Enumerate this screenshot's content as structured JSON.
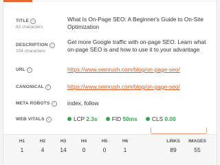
{
  "fields": {
    "title": {
      "label": "TITLE",
      "sub": "63 characters",
      "value": "What Is On-Page SEO: A Beginner's Guide to On-Site Optimization"
    },
    "description": {
      "label": "DESCRIPTION",
      "sub": "104 characters",
      "value": "Get more Google traffic with on-page SEO. Learn what on-page SEO is and how to use it to your advantage"
    },
    "url": {
      "label": "URL",
      "value": "https://www.semrush.com/blog/on-page-seo/"
    },
    "canonical": {
      "label": "CANONICAL",
      "value": "https://www.semrush.com/blog/on-page-seo/"
    },
    "meta_robots": {
      "label": "META ROBOTS",
      "value": "index, follow"
    },
    "web_vitals": {
      "label": "WEB VITALS",
      "items": [
        {
          "name": "LCP",
          "value": "2.3s"
        },
        {
          "name": "FID",
          "value": "50ms"
        },
        {
          "name": "CLS",
          "value": "0.00"
        }
      ]
    }
  },
  "info_glyph": "i",
  "stats": [
    {
      "label": "H1",
      "value": "1"
    },
    {
      "label": "H2",
      "value": "4"
    },
    {
      "label": "H3",
      "value": "14"
    },
    {
      "label": "H4",
      "value": "0"
    },
    {
      "label": "H5",
      "value": "0"
    },
    {
      "label": "H6",
      "value": "1"
    },
    {
      "label": "LINKS",
      "value": "89"
    },
    {
      "label": "IMAGES",
      "value": "55"
    }
  ],
  "colors": {
    "accent": "#e8672e",
    "link": "#d75c23",
    "good": "#2fa84f"
  }
}
